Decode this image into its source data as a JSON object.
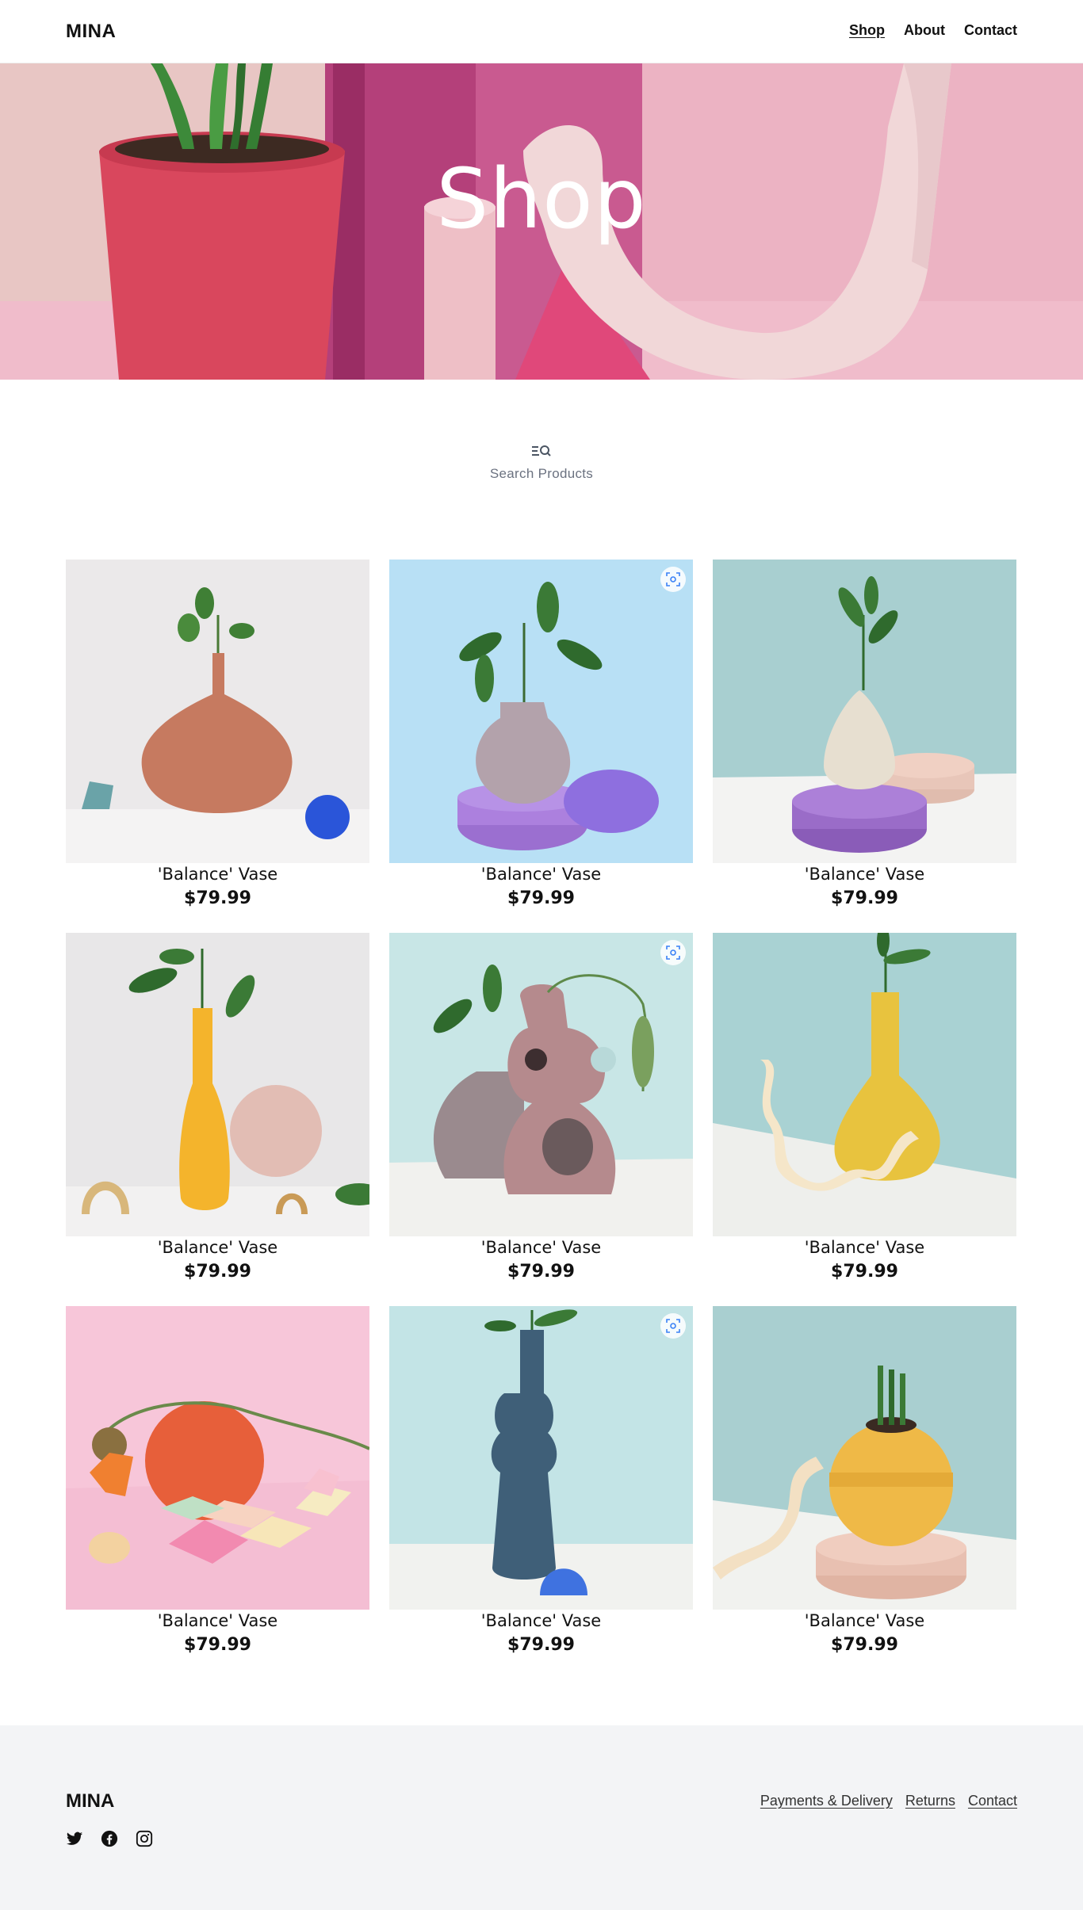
{
  "header": {
    "brand": "MINA",
    "nav": [
      {
        "label": "Shop",
        "active": true
      },
      {
        "label": "About",
        "active": false
      },
      {
        "label": "Contact",
        "active": false
      }
    ]
  },
  "hero": {
    "title": "Shop"
  },
  "search": {
    "icon": "search-list-icon",
    "label": "Search Products"
  },
  "products": [
    {
      "name": "'Balance' Vase",
      "price": "$79.99",
      "quick_view": false
    },
    {
      "name": "'Balance' Vase",
      "price": "$79.99",
      "quick_view": true
    },
    {
      "name": "'Balance' Vase",
      "price": "$79.99",
      "quick_view": false
    },
    {
      "name": "'Balance' Vase",
      "price": "$79.99",
      "quick_view": false
    },
    {
      "name": "'Balance' Vase",
      "price": "$79.99",
      "quick_view": true
    },
    {
      "name": "'Balance' Vase",
      "price": "$79.99",
      "quick_view": false
    },
    {
      "name": "'Balance' Vase",
      "price": "$79.99",
      "quick_view": false
    },
    {
      "name": "'Balance' Vase",
      "price": "$79.99",
      "quick_view": true
    },
    {
      "name": "'Balance' Vase",
      "price": "$79.99",
      "quick_view": false
    }
  ],
  "footer": {
    "brand": "MINA",
    "socials": [
      "twitter-icon",
      "facebook-icon",
      "instagram-icon"
    ],
    "links": [
      "Payments & Delivery",
      "Returns",
      "Contact"
    ]
  },
  "colors": {
    "hero_pink": "#ecb3c3",
    "footer_bg": "#f3f4f6",
    "text": "#111111",
    "muted": "#6b7280"
  }
}
